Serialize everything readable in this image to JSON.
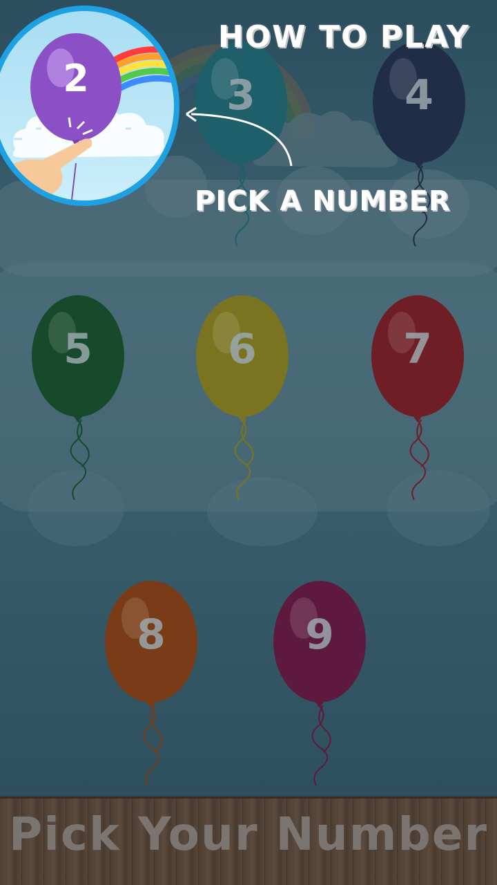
{
  "title": "HOW TO PLAY",
  "instruction": "PICK A NUMBER",
  "tutorial": {
    "balloon_number": "2"
  },
  "balloons": [
    {
      "number": "3",
      "color": "#1f5f6a"
    },
    {
      "number": "4",
      "color": "#1f2d47"
    },
    {
      "number": "5",
      "color": "#174a2a"
    },
    {
      "number": "6",
      "color": "#7a7420"
    },
    {
      "number": "7",
      "color": "#6e1e24"
    },
    {
      "number": "8",
      "color": "#7a3c16"
    },
    {
      "number": "9",
      "color": "#5e1a3e"
    }
  ],
  "footer": "Pick Your Number",
  "colors": {
    "overlay": "#2c4a58",
    "tutorial_ring": "#1da1e3",
    "tutorial_balloon": "#8b4fc6"
  }
}
